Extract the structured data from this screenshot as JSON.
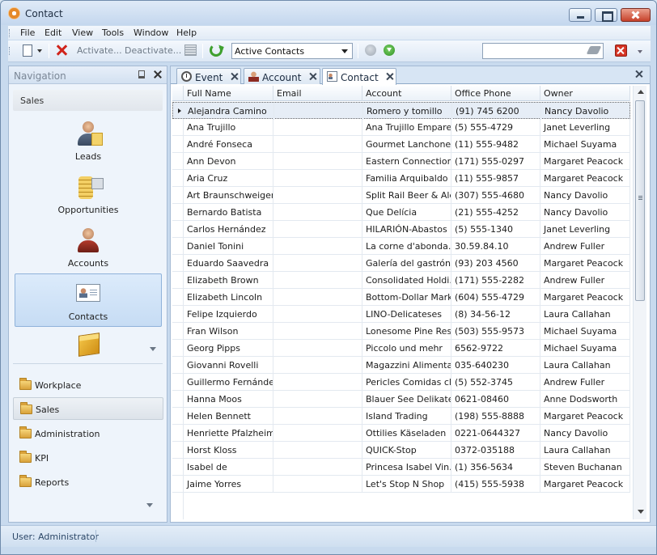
{
  "window": {
    "title": "Contact"
  },
  "menu": [
    "File",
    "Edit",
    "View",
    "Tools",
    "Window",
    "Help"
  ],
  "toolbar": {
    "activate_label": "Activate...",
    "deactivate_label": "Deactivate...",
    "view_selected": "Active Contacts",
    "search_value": ""
  },
  "navigation": {
    "title": "Navigation",
    "section": "Sales",
    "tiles": [
      {
        "label": "Leads",
        "icon": "lead-icon"
      },
      {
        "label": "Opportunities",
        "icon": "coins-icon"
      },
      {
        "label": "Accounts",
        "icon": "account-icon"
      },
      {
        "label": "Contacts",
        "icon": "contact-card-icon"
      }
    ],
    "groups": [
      {
        "label": "Workplace"
      },
      {
        "label": "Sales"
      },
      {
        "label": "Administration"
      },
      {
        "label": "KPI"
      },
      {
        "label": "Reports"
      }
    ]
  },
  "tabs": [
    {
      "label": "Event",
      "icon": "clock-icon"
    },
    {
      "label": "Account",
      "icon": "account-icon"
    },
    {
      "label": "Contact",
      "icon": "contact-card-icon"
    }
  ],
  "grid": {
    "columns": [
      "Full Name",
      "Email",
      "Account",
      "Office Phone",
      "Owner"
    ],
    "rows": [
      [
        "Alejandra Camino",
        "",
        "Romero y tomillo",
        "(91) 745 6200",
        "Nancy Davolio"
      ],
      [
        "Ana Trujillo",
        "",
        "Ana Trujillo Empare...",
        "(5) 555-4729",
        "Janet Leverling"
      ],
      [
        "André Fonseca",
        "",
        "Gourmet Lanchone...",
        "(11) 555-9482",
        "Michael Suyama"
      ],
      [
        "Ann Devon",
        "",
        "Eastern Connection",
        "(171) 555-0297",
        "Margaret Peacock"
      ],
      [
        "Aria Cruz",
        "",
        "Familia Arquibaldo",
        "(11) 555-9857",
        "Margaret Peacock"
      ],
      [
        "Art Braunschweiger",
        "",
        "Split Rail Beer & Ale",
        "(307) 555-4680",
        "Nancy Davolio"
      ],
      [
        "Bernardo Batista",
        "",
        "Que Delícia",
        "(21) 555-4252",
        "Nancy Davolio"
      ],
      [
        "Carlos Hernández",
        "",
        "HILARIÓN-Abastos",
        "(5) 555-1340",
        "Janet Leverling"
      ],
      [
        "Daniel Tonini",
        "",
        "La corne d'abonda...",
        "30.59.84.10",
        "Andrew Fuller"
      ],
      [
        "Eduardo Saavedra",
        "",
        "Galería del gastrón...",
        "(93) 203 4560",
        "Margaret Peacock"
      ],
      [
        "Elizabeth Brown",
        "",
        "Consolidated Holdi...",
        "(171) 555-2282",
        "Andrew Fuller"
      ],
      [
        "Elizabeth Lincoln",
        "",
        "Bottom-Dollar Mark...",
        "(604) 555-4729",
        "Margaret Peacock"
      ],
      [
        "Felipe Izquierdo",
        "",
        "LINO-Delicateses",
        "(8) 34-56-12",
        "Laura Callahan"
      ],
      [
        "Fran Wilson",
        "",
        "Lonesome Pine Res...",
        "(503) 555-9573",
        "Michael Suyama"
      ],
      [
        "Georg Pipps",
        "",
        "Piccolo und mehr",
        "6562-9722",
        "Michael Suyama"
      ],
      [
        "Giovanni Rovelli",
        "",
        "Magazzini Alimenta...",
        "035-640230",
        "Laura Callahan"
      ],
      [
        "Guillermo Fernández",
        "",
        "Pericles Comidas cl...",
        "(5) 552-3745",
        "Andrew Fuller"
      ],
      [
        "Hanna Moos",
        "",
        "Blauer See Delikate...",
        "0621-08460",
        "Anne Dodsworth"
      ],
      [
        "Helen Bennett",
        "",
        "Island Trading",
        "(198) 555-8888",
        "Margaret Peacock"
      ],
      [
        "Henriette Pfalzheim",
        "",
        "Ottilies Käseladen",
        "0221-0644327",
        "Nancy Davolio"
      ],
      [
        "Horst Kloss",
        "",
        "QUICK-Stop",
        "0372-035188",
        "Laura Callahan"
      ],
      [
        "Isabel de",
        "",
        "Princesa Isabel Vin...",
        "(1) 356-5634",
        "Steven Buchanan"
      ],
      [
        "Jaime Yorres",
        "",
        "Let's Stop N Shop",
        "(415) 555-5938",
        "Margaret Peacock"
      ]
    ]
  },
  "status": {
    "user": "User: Administrator"
  }
}
